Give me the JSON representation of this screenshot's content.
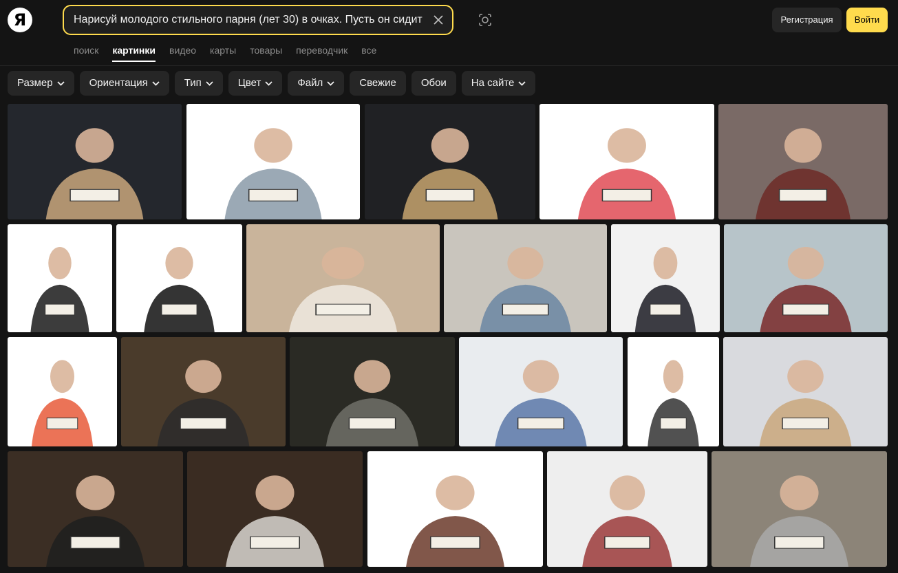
{
  "header": {
    "logo_text": "Я",
    "search_value": "Нарисуй молодого стильного парня (лет 30) в очках. Пусть он сидит",
    "register_label": "Регистрация",
    "login_label": "Войти"
  },
  "nav": {
    "items": [
      "поиск",
      "картинки",
      "видео",
      "карты",
      "товары",
      "переводчик",
      "все"
    ],
    "active_index": 1
  },
  "filters": [
    {
      "label": "Размер",
      "dropdown": true
    },
    {
      "label": "Ориентация",
      "dropdown": true
    },
    {
      "label": "Тип",
      "dropdown": true
    },
    {
      "label": "Цвет",
      "dropdown": true
    },
    {
      "label": "Файл",
      "dropdown": true
    },
    {
      "label": "Свежие",
      "dropdown": false
    },
    {
      "label": "Обои",
      "dropdown": false
    },
    {
      "label": "На сайте",
      "dropdown": true
    }
  ],
  "results": {
    "rows": [
      [
        {
          "bg": "#24272d",
          "fg": "#c9a77c"
        },
        {
          "bg": "#ffffff",
          "fg": "#8a9aa8"
        },
        {
          "bg": "#202124",
          "fg": "#c7a36e"
        },
        {
          "bg": "#ffffff",
          "fg": "#e04b55"
        },
        {
          "bg": "#7a6a66",
          "fg": "#6d2a27"
        }
      ],
      [
        {
          "bg": "#ffffff",
          "fg": "#1a1a1a"
        },
        {
          "bg": "#ffffff",
          "fg": "#111111"
        },
        {
          "bg": "#c9b49b",
          "fg": "#efe9e0"
        },
        {
          "bg": "#c9c5bd",
          "fg": "#6b86a3"
        },
        {
          "bg": "#f2f2f2",
          "fg": "#1c1c24"
        },
        {
          "bg": "#b7c4c9",
          "fg": "#7a2a2a"
        }
      ],
      [
        {
          "bg": "#ffffff",
          "fg": "#e85b3a"
        },
        {
          "bg": "#4a3b2b",
          "fg": "#2b2b2b"
        },
        {
          "bg": "#2a2a24",
          "fg": "#707069"
        },
        {
          "bg": "#e9ecef",
          "fg": "#5a78a8"
        },
        {
          "bg": "#ffffff",
          "fg": "#333333"
        },
        {
          "bg": "#d9dade",
          "fg": "#c9a77c"
        }
      ],
      [
        {
          "bg": "#3b2e24",
          "fg": "#1f1f1f"
        },
        {
          "bg": "#3a2c22",
          "fg": "#d8d5cf"
        },
        {
          "bg": "#ffffff",
          "fg": "#6b3a2a"
        },
        {
          "bg": "#eeeeee",
          "fg": "#9b3a3a"
        },
        {
          "bg": "#8c8478",
          "fg": "#a9a9a9"
        }
      ]
    ]
  }
}
